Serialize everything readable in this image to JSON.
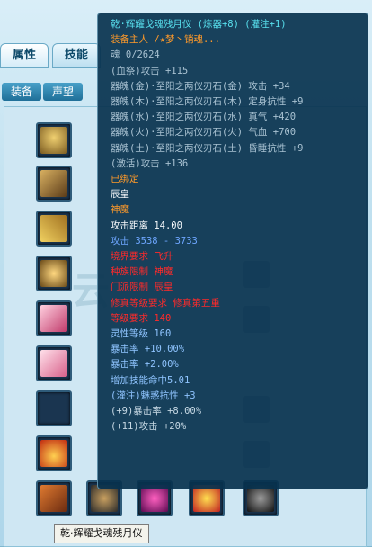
{
  "tabs": [
    {
      "label": "属性"
    },
    {
      "label": "技能"
    }
  ],
  "subtabs": [
    {
      "label": "装备"
    },
    {
      "label": "声望"
    }
  ],
  "watermark": "云",
  "tooltip": {
    "lines": [
      {
        "text": "乾·辉耀戈魂残月仪 (炼器+8) (灌注+1)",
        "color": "cyan"
      },
      {
        "text": "装备主人 /★梦丶销魂...",
        "color": "orange"
      },
      {
        "text": "魂 0/2624",
        "color": "gray"
      },
      {
        "text": "(血祭)攻击 +115",
        "color": "gray"
      },
      {
        "text": "器魄(金)·至阳之两仪刃石(金) 攻击 +34",
        "color": "gray"
      },
      {
        "text": "器魄(木)·至阳之两仪刃石(木) 定身抗性 +9",
        "color": "gray"
      },
      {
        "text": "器魄(水)·至阳之两仪刃石(水) 真气 +420",
        "color": "gray"
      },
      {
        "text": "器魄(火)·至阳之两仪刃石(火) 气血 +700",
        "color": "gray"
      },
      {
        "text": "器魄(土)·至阳之两仪刃石(土) 昏睡抗性 +9",
        "color": "gray"
      },
      {
        "text": "(激活)攻击 +136",
        "color": "gray"
      },
      {
        "text": "已绑定",
        "color": "orange"
      },
      {
        "text": "辰皇",
        "color": "white"
      },
      {
        "text": "神魔",
        "color": "orange"
      },
      {
        "text": "攻击距离 14.00",
        "color": "white"
      },
      {
        "text": "攻击 3538 - 3733",
        "color": "blue"
      },
      {
        "text": "境界要求 飞升",
        "color": "red"
      },
      {
        "text": "种族限制 神魔",
        "color": "red"
      },
      {
        "text": "门派限制 辰皇",
        "color": "red"
      },
      {
        "text": "修真等级要求 修真第五重",
        "color": "red"
      },
      {
        "text": "等级要求 140",
        "color": "red"
      },
      {
        "text": "灵性等级 160",
        "color": "lblue"
      },
      {
        "text": "暴击率 +10.00%",
        "color": "lblue"
      },
      {
        "text": "暴击率 +2.00%",
        "color": "lblue"
      },
      {
        "text": "增加技能命中5.01",
        "color": "lblue"
      },
      {
        "text": "(灌注)魅惑抗性 +3",
        "color": "lblue"
      },
      {
        "text": "(+9)暴击率 +8.00%",
        "color": "lgray"
      },
      {
        "text": "(+11)攻击 +20%",
        "color": "lgray"
      }
    ]
  },
  "caption": "乾·辉耀戈魂残月仪",
  "slots": [
    {
      "name": "equip-slot-1",
      "icon": "helmet-icon",
      "color": "#b08a3a"
    },
    {
      "name": "equip-slot-2",
      "icon": "armor-icon",
      "color": "#7a5a2a"
    },
    {
      "name": "equip-slot-3",
      "icon": "belt-icon",
      "color": "#c9a13b"
    },
    {
      "name": "equip-slot-4",
      "icon": "shoulder-icon",
      "color": "#a07830"
    },
    {
      "name": "equip-slot-5",
      "icon": "ribbon-icon",
      "color": "#d86a8a"
    },
    {
      "name": "equip-slot-6",
      "icon": "ribbon-icon",
      "color": "#e48ca8"
    },
    {
      "name": "equip-slot-7",
      "icon": "empty-slot-icon",
      "color": "#1a3550"
    },
    {
      "name": "equip-slot-8",
      "icon": "crown-icon",
      "color": "#c8461a"
    },
    {
      "name": "equip-slot-9",
      "icon": "weapon-icon",
      "color": "#b85a20"
    },
    {
      "name": "equip-slot-10",
      "icon": "orb-icon",
      "color": "#3a3a3a"
    },
    {
      "name": "equip-slot-11",
      "icon": "gem-icon",
      "color": "#c02a8a"
    },
    {
      "name": "equip-slot-12",
      "icon": "mask-icon",
      "color": "#d8a020"
    },
    {
      "name": "equip-slot-13",
      "icon": "ring-icon",
      "color": "#202020"
    }
  ]
}
